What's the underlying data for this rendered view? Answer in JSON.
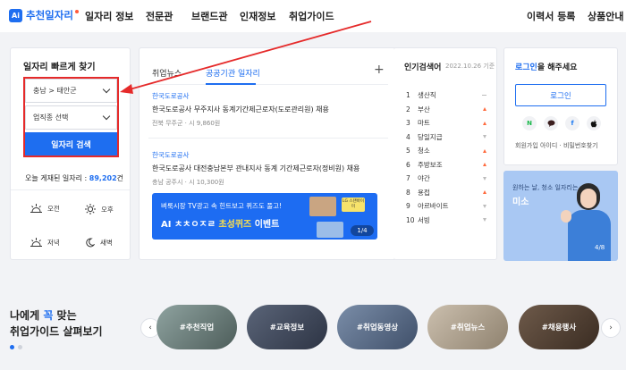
{
  "nav": {
    "logo_badge": "Ai",
    "logo_text": "추천일자리",
    "items": [
      "일자리 정보",
      "전문관",
      "브랜드관",
      "인재정보",
      "취업가이드"
    ],
    "right_items": [
      "이력서 등록",
      "상품안내"
    ]
  },
  "quick_search": {
    "title": "일자리 빠르게 찾기",
    "region": "충남 > 태안군",
    "job_placeholder": "업직종 선택",
    "search_label": "일자리 검색",
    "count_prefix": "오늘 게재된 일자리 :",
    "count_value": "89,202",
    "count_suffix": "건",
    "time_filters": [
      "오전",
      "오후",
      "저녁",
      "새벽"
    ]
  },
  "news": {
    "tabs": [
      "취업뉴스",
      "공공기관 일자리"
    ],
    "active_tab": 1,
    "plus": "+",
    "jobs": [
      {
        "company": "한국도로공사",
        "title": "한국도로공사 무주지사 동계기간제근로자(도로관리원) 채용",
        "meta": "전북 무주군 · 시 9,860원"
      },
      {
        "company": "한국도로공사",
        "title": "한국도로공사 대전충남본부 관내지사 동계 기간제근로자(정비원) 채용",
        "meta": "충남 공주시 · 시 10,300원"
      }
    ],
    "banner": {
      "top": "벼룩시장 TV광고 속 힌트보고 퀴즈도 풀고!",
      "main_prefix": "AI ㅊㅊㅇㅈㄹ",
      "main_yellow": "초성퀴즈",
      "main_suffix": "이벤트",
      "badge": "LG 스탠바이미",
      "page": "1/4"
    }
  },
  "popular": {
    "title": "인기검색어",
    "date": "2022.10.26 기준",
    "items": [
      {
        "rank": "1",
        "word": "생산직",
        "trend": "same"
      },
      {
        "rank": "2",
        "word": "부산",
        "trend": "up"
      },
      {
        "rank": "3",
        "word": "마트",
        "trend": "up"
      },
      {
        "rank": "4",
        "word": "당일지급",
        "trend": "down"
      },
      {
        "rank": "5",
        "word": "청소",
        "trend": "up"
      },
      {
        "rank": "6",
        "word": "주방보조",
        "trend": "up"
      },
      {
        "rank": "7",
        "word": "야간",
        "trend": "down"
      },
      {
        "rank": "8",
        "word": "용접",
        "trend": "up"
      },
      {
        "rank": "9",
        "word": "아르바이트",
        "trend": "down"
      },
      {
        "rank": "10",
        "word": "서빙",
        "trend": "down"
      }
    ]
  },
  "login": {
    "prompt_blue": "로그인",
    "prompt_rest": "을 해주세요",
    "button": "로그인",
    "socials": [
      "N",
      "💬",
      "f",
      ""
    ],
    "links": "회원가입   아이디 · 비밀번호찾기"
  },
  "promo": {
    "sub": "원하는 날, 청소 일자리는",
    "name": "미소",
    "page": "4/8"
  },
  "guide": {
    "line1_prefix": "나에게 ",
    "line1_blue": "꼭",
    "line1_suffix": " 맞는",
    "line2": "취업가이드 살펴보기",
    "pills": [
      "#추천직업",
      "#교육정보",
      "#취업동영상",
      "#취업뉴스",
      "#채용행사"
    ],
    "prev": "‹",
    "next": "›"
  },
  "colors": {
    "accent": "#1e6ef0",
    "annotation_red": "#e52a2a",
    "up": "#ff6a3d"
  }
}
